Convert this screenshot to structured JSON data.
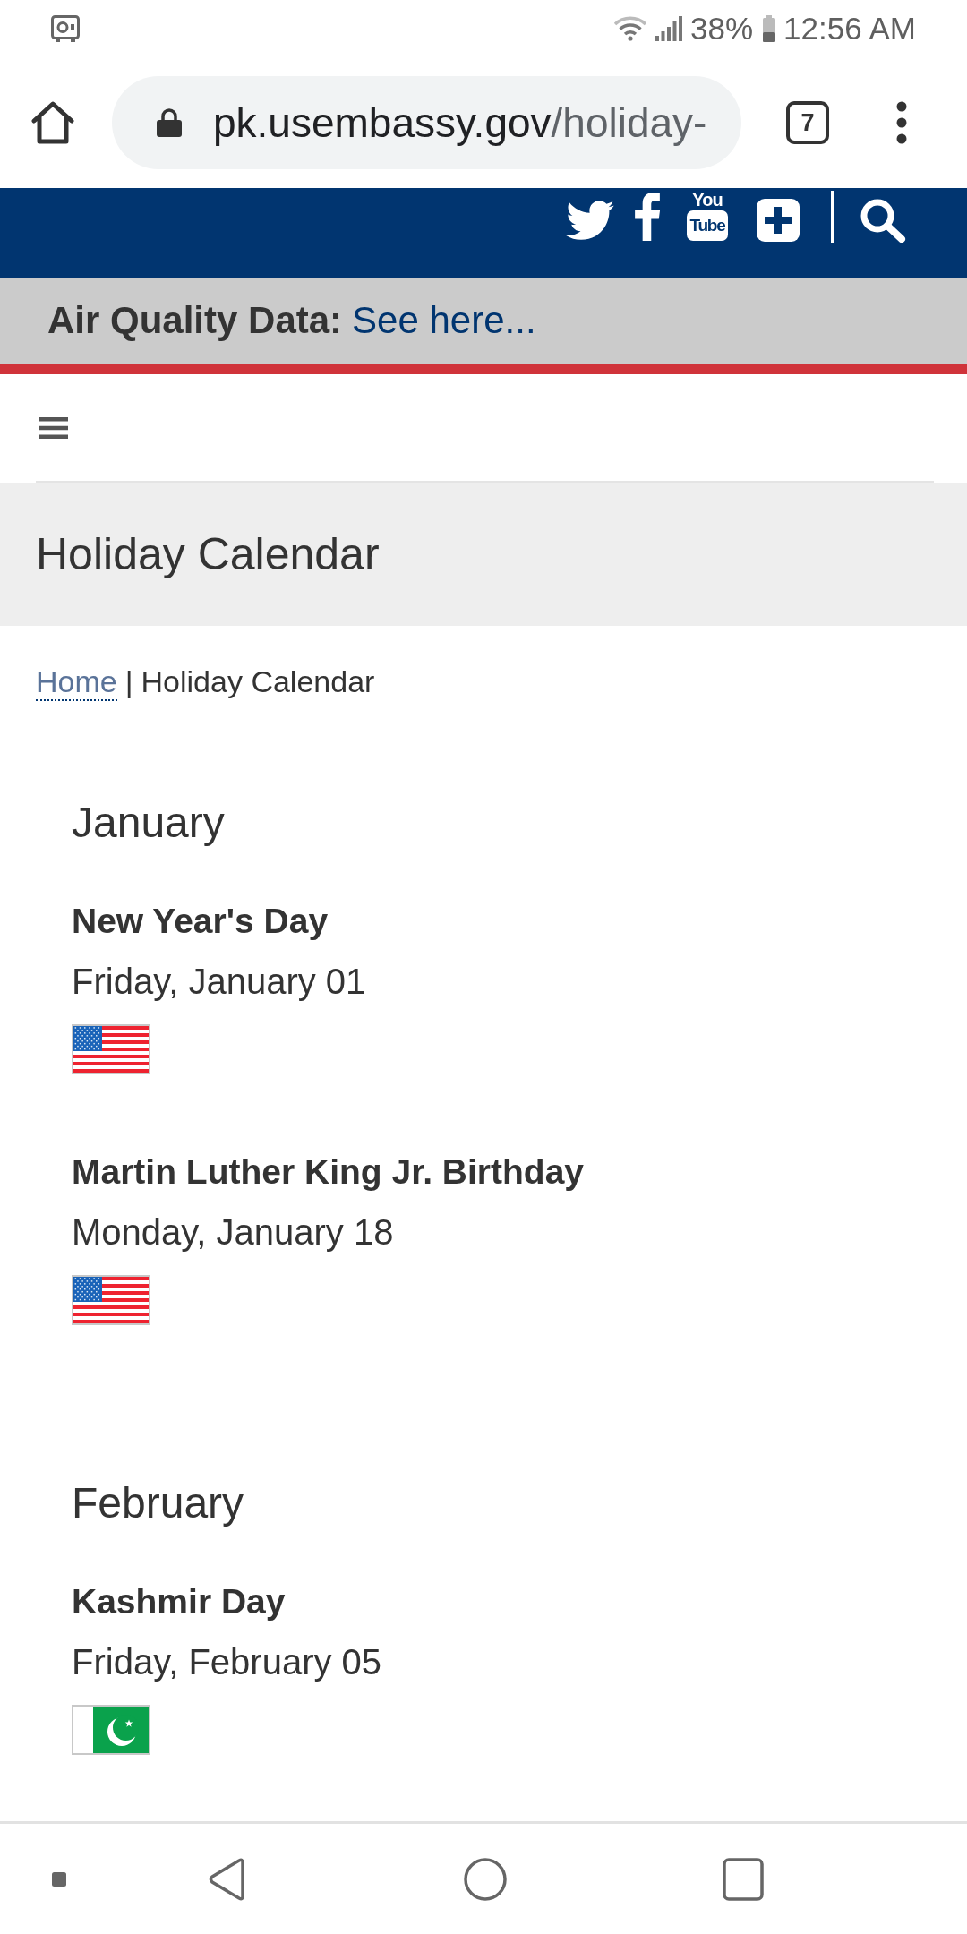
{
  "status_bar": {
    "battery": "38%",
    "time": "12:56 AM"
  },
  "browser": {
    "url_host": "pk.usembassy.gov",
    "url_path": "/holiday-",
    "tab_count": "7"
  },
  "site_header": {
    "youtube_logo": {
      "top": "You",
      "bottom": "Tube"
    },
    "air_quality_label": "Air Quality Data:",
    "air_quality_link": "See here..."
  },
  "page_title": "Holiday Calendar",
  "breadcrumb": {
    "link": "Home",
    "separator": "|",
    "current": "Holiday Calendar"
  },
  "months": [
    {
      "name": "January",
      "holidays": [
        {
          "name": "New Year's Day",
          "date": "Friday, January 01",
          "kind": "american"
        },
        {
          "name": "Martin Luther King Jr. Birthday",
          "date": "Monday, January 18",
          "kind": "american"
        }
      ]
    },
    {
      "name": "February",
      "holidays": [
        {
          "name": "Kashmir Day",
          "date": "Friday, February 05",
          "kind": "pakistani"
        }
      ]
    }
  ]
}
